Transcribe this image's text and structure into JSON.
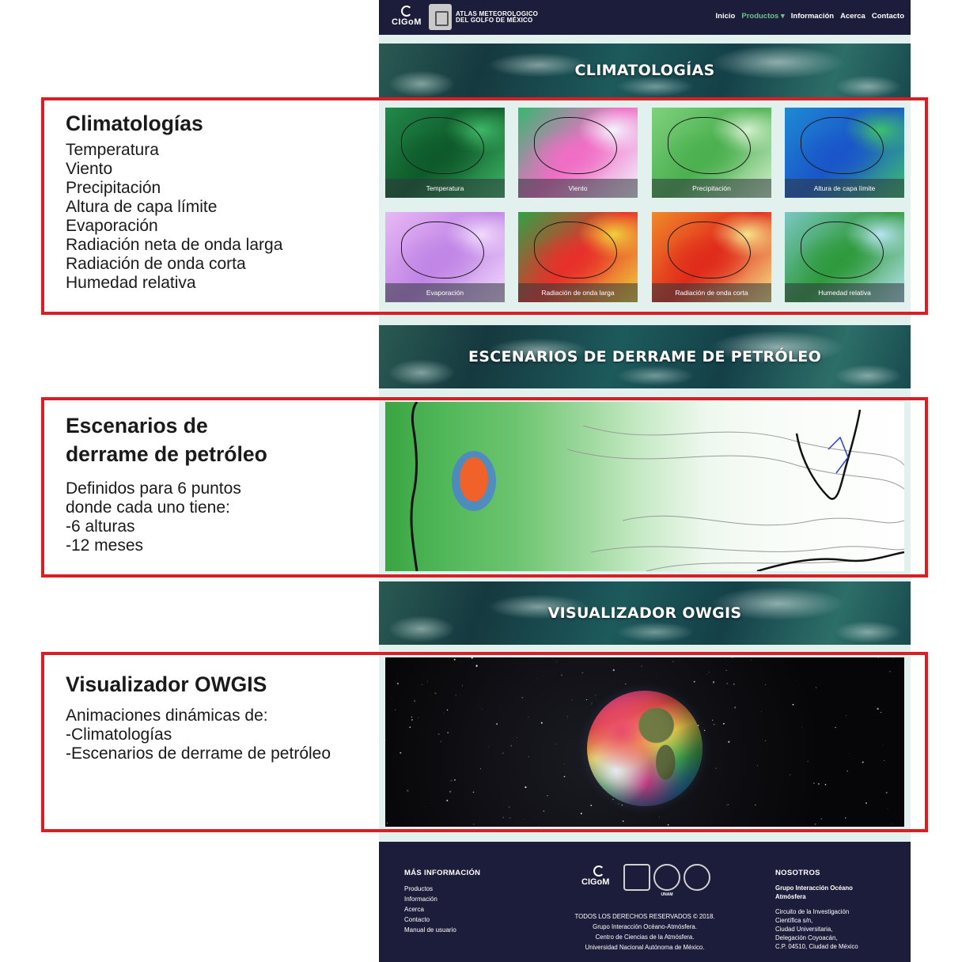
{
  "navbar": {
    "logo": "CIGoM",
    "atlas_title_line1": "ATLAS METEOROLOGICO",
    "atlas_title_line2": "DEL GOLFO DE MÉXICO",
    "links": [
      "Inicio",
      "Productos ▾",
      "Información",
      "Acerca",
      "Contacto"
    ],
    "active_link": "Productos ▾"
  },
  "sections": {
    "climatologias_banner": "CLIMATOLOGÍAS",
    "spill_banner": "ESCENARIOS DE DERRAME DE PETRÓLEO",
    "owgis_banner": "VISUALIZADOR OWGIS"
  },
  "thumbnails": [
    {
      "label": "Temperatura",
      "palette": [
        "#0e5a2a",
        "#23894a",
        "#3fb868"
      ]
    },
    {
      "label": "Viento",
      "palette": [
        "#f06ec5",
        "#35b870",
        "#f4f4ff"
      ]
    },
    {
      "label": "Precipitación",
      "palette": [
        "#4bb04f",
        "#7fd17d",
        "#d5f0cf"
      ]
    },
    {
      "label": "Altura de capa límite",
      "palette": [
        "#1a56c9",
        "#1e8ad3",
        "#3ec16d"
      ]
    },
    {
      "label": "Evaporación",
      "palette": [
        "#c186e6",
        "#e8b8f5",
        "#f2dafd"
      ]
    },
    {
      "label": "Radiación de onda larga",
      "palette": [
        "#e8302a",
        "#2ea245",
        "#f0d23a"
      ]
    },
    {
      "label": "Radiación de onda corta",
      "palette": [
        "#e02b1b",
        "#f08a2a",
        "#f7e58a"
      ]
    },
    {
      "label": "Humedad relativa",
      "palette": [
        "#2f9a3d",
        "#7cc7c4",
        "#b8e4f2"
      ]
    }
  ],
  "annotations": {
    "climatologias": {
      "title": "Climatologías",
      "lines": [
        "Temperatura",
        "Viento",
        "Precipitación",
        "Altura de capa límite",
        "Evaporación",
        "Radiación neta de onda larga",
        "Radiación de onda corta",
        "Humedad relativa"
      ]
    },
    "spill": {
      "title_line1": "Escenarios de",
      "title_line2": "derrame de petróleo",
      "lines": [
        "Definidos para 6 puntos",
        "donde cada uno tiene:",
        "-6 alturas",
        "-12 meses"
      ]
    },
    "owgis": {
      "title": "Visualizador OWGIS",
      "lines": [
        "Animaciones dinámicas de:",
        "-Climatologías",
        "-Escenarios de derrame de petróleo"
      ]
    }
  },
  "footer": {
    "more_info_heading": "MÁS INFORMACIÓN",
    "more_info_links": [
      "Productos",
      "Información",
      "Acerca",
      "Contacto",
      "Manual de usuario"
    ],
    "logo": "CIGoM",
    "unam_label": "UNAM",
    "copyright_lines": [
      "TODOS LOS DERECHOS RESERVADOS © 2018.",
      "Grupo Interacción Océano-Atmósfera.",
      "Centro de Ciencias de la Atmósfera.",
      "Universidad Nacional Autónoma de México."
    ],
    "nosotros_heading": "NOSOTROS",
    "group_line1": "Grupo Interacción Océano",
    "group_line2": "Atmósfera",
    "address_lines": [
      "Circuito de la Investigación",
      "Científica s/n,",
      "Ciudad Universitaria,",
      "Delegación Coyoacán,",
      "C.P. 04510, Ciudad de México"
    ]
  },
  "colors": {
    "annotation_border": "#d81f25",
    "navbar_bg": "#1c1d3a",
    "nav_active": "#6fc38d",
    "page_bg": "#e2f1ee"
  }
}
